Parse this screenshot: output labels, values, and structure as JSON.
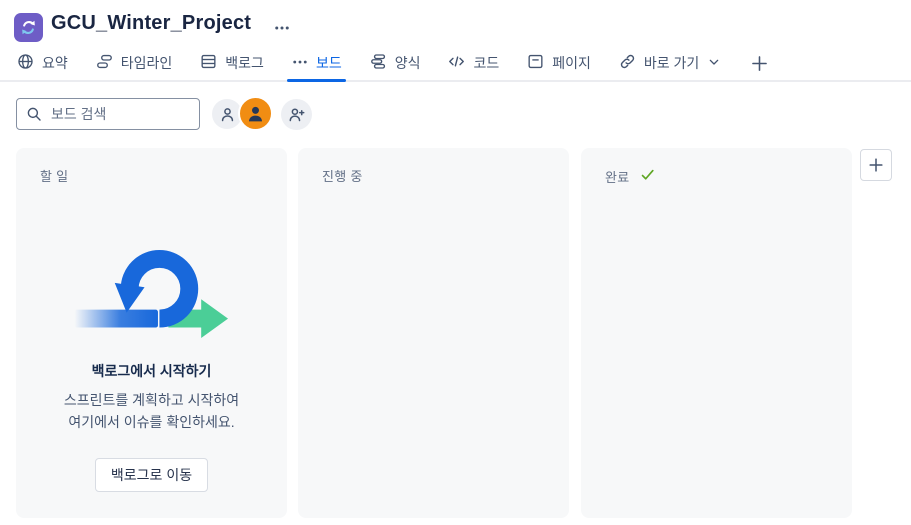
{
  "header": {
    "project_title": "GCU_Winter_Project"
  },
  "tabs": {
    "items": [
      {
        "label": "요약",
        "icon": "globe-icon"
      },
      {
        "label": "타임라인",
        "icon": "timeline-icon"
      },
      {
        "label": "백로그",
        "icon": "backlog-icon"
      },
      {
        "label": "보드",
        "icon": "more-dots-icon",
        "active": true
      },
      {
        "label": "양식",
        "icon": "forms-icon"
      },
      {
        "label": "코드",
        "icon": "code-icon"
      },
      {
        "label": "페이지",
        "icon": "pages-icon"
      },
      {
        "label": "바로 가기",
        "icon": "link-icon",
        "has_chevron": true
      }
    ]
  },
  "toolbar": {
    "search_placeholder": "보드 검색"
  },
  "board": {
    "columns": [
      {
        "title": "할 일"
      },
      {
        "title": "진행 중"
      },
      {
        "title": "완료",
        "done_check": true
      }
    ],
    "empty_state": {
      "heading": "백로그에서 시작하기",
      "description": "스프린트를 계획하고 시작하여\n여기에서 이슈를 확인하세요.",
      "button_label": "백로그로 이동"
    }
  },
  "colors": {
    "active_tab_blue": "#0C66E4",
    "project_icon_purple": "#6E5DC6",
    "avatar_orange": "#F18D13",
    "column_bg": "#F7F8F9",
    "done_check_green": "#5FA624",
    "illustration_blue": "#1868DB",
    "illustration_green": "#4BCE97"
  }
}
